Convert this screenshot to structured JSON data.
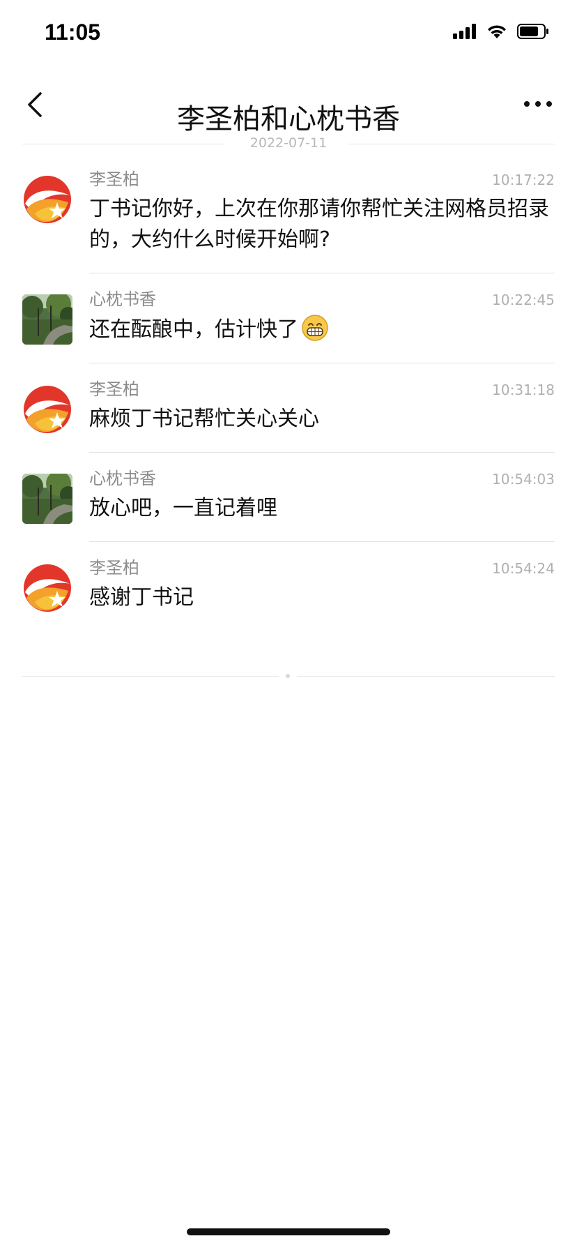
{
  "status_bar": {
    "time": "11:05",
    "icons": [
      "signal-icon",
      "wifi-icon",
      "battery-icon"
    ]
  },
  "nav": {
    "title": "李圣柏和心枕书香",
    "back_icon": "chevron-left-icon",
    "more_icon": "more-dots-icon"
  },
  "date_divider": "2022-07-11",
  "messages": [
    {
      "sender": "李圣柏",
      "time": "10:17:22",
      "text": "丁书记你好，上次在你那请你帮忙关注网格员招录的，大约什么时候开始啊?",
      "avatar": "logo-avatar"
    },
    {
      "sender": "心枕书香",
      "time": "10:22:45",
      "text": "还在酝酿中，估计快了",
      "emoji": "grin-emoji-icon",
      "avatar": "landscape-avatar"
    },
    {
      "sender": "李圣柏",
      "time": "10:31:18",
      "text": "麻烦丁书记帮忙关心关心",
      "avatar": "logo-avatar"
    },
    {
      "sender": "心枕书香",
      "time": "10:54:03",
      "text": "放心吧，一直记着哩",
      "avatar": "landscape-avatar"
    },
    {
      "sender": "李圣柏",
      "time": "10:54:24",
      "text": "感谢丁书记",
      "avatar": "logo-avatar"
    }
  ],
  "colors": {
    "text_primary": "#111111",
    "text_secondary": "#8c8c8c",
    "time_text": "#b0b0b0",
    "divider": "#e5e5e5"
  }
}
